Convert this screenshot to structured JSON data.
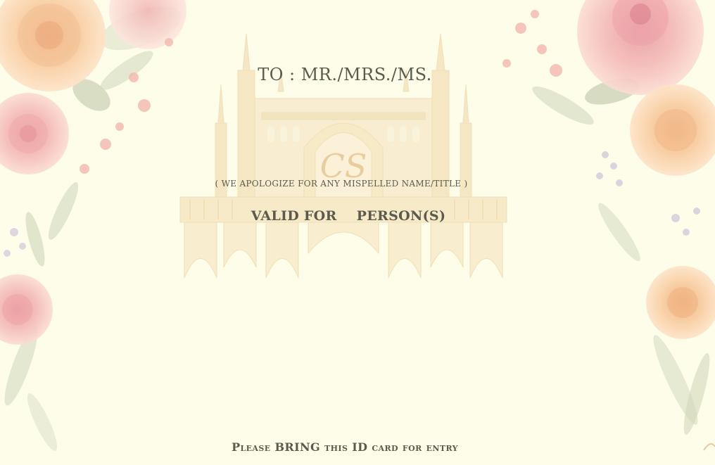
{
  "card": {
    "to_label": "TO : MR./MRS./MS.",
    "apology": "( WE APOLOGIZE FOR ANY MISPELLED NAME/TITLE )",
    "valid_for": "VALID FOR",
    "persons": "PERSON(S)",
    "bring_notice": "Please BRING this ID card for entry",
    "monogram": "CS"
  },
  "colors": {
    "background": "#fdfde9",
    "text": "#5c5a4c",
    "castle": "#f1dcb2",
    "rose_pink": "#f4b6b4",
    "rose_peach": "#f9cc9c",
    "leaf": "#c9cfb3",
    "lavender": "#c9b8d8"
  },
  "decorations": {
    "castle_watermark": "castle-icon",
    "florals": "rose-flowers"
  }
}
